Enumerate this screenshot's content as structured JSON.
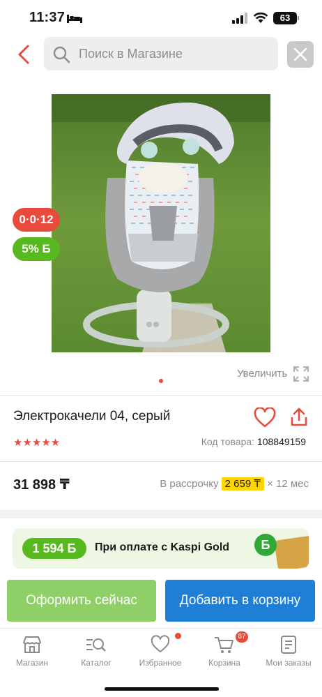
{
  "status_bar": {
    "time": "11:37",
    "battery": "63"
  },
  "search": {
    "placeholder": "Поиск в Магазине"
  },
  "product": {
    "badge_installment": "0·0·12",
    "badge_bonus": "5% Б",
    "zoom_label": "Увеличить",
    "title": "Электрокачели 04, серый",
    "rating": "★★★★★",
    "code_label": "Код товара:",
    "code_value": "108849159",
    "price": "31 898 ₸",
    "installment_label": "В рассрочку",
    "installment_amount": "2 659 ₸",
    "installment_term": "× 12 мес"
  },
  "bonus_banner": {
    "amount": "1 594 Б",
    "text": "При оплате с Kaspi Gold",
    "coin": "Б"
  },
  "actions": {
    "checkout": "Оформить сейчас",
    "add_to_cart": "Добавить в корзину"
  },
  "tabbar": {
    "items": [
      {
        "label": "Магазин",
        "icon": "shop-icon"
      },
      {
        "label": "Каталог",
        "icon": "catalog-search-icon"
      },
      {
        "label": "Избранное",
        "icon": "heart-icon"
      },
      {
        "label": "Корзина",
        "icon": "cart-icon",
        "badge": "87"
      },
      {
        "label": "Мои заказы",
        "icon": "orders-icon"
      }
    ]
  },
  "colors": {
    "accent_red": "#e84a3c",
    "kaspi_green": "#58b91e",
    "primary_blue": "#1f7fd6",
    "installment_yellow": "#ffd600"
  }
}
